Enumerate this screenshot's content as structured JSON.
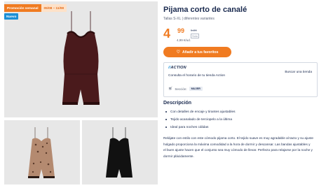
{
  "badges": {
    "promo_label": "Promoción semanal",
    "promo_dates": "05/08 – 11/08",
    "new_label": "Nuevo"
  },
  "product": {
    "title": "Pijama corto de canalé",
    "variants": "Tallas S-XL | diferentes variantes",
    "price_int": "4",
    "price_dec": "99",
    "old_price": "5,99",
    "sale_tag": "Solo",
    "unit_price": "4,99 €/ud.",
    "fav_button": "Añadir a tus favoritos"
  },
  "store": {
    "logo": "ACTION",
    "consult": "Consulta el horario de tu tienda Action",
    "find_store": "Buscar una tienda",
    "section_label": "Sección:",
    "section_value": "MUJER"
  },
  "description": {
    "title": "Descripción",
    "bullets": [
      "Con detalles de encaje y tirantes ajustables",
      "Tejido acanalado de terciopelo a la última",
      "Ideal para noches cálidas"
    ],
    "text": "Relájate con estilo con este cómodo pijama corto. El tejido suave es muy agradable al tacto y su ajuste holgado proporciona la máxima comodidad a la hora de dormir y descansar. Las bandas ajustables y el buen ajuste hacen que el conjunto sea muy cómodo de llevar. Perfecto para relajarse por la noche y dormir plácidamente."
  },
  "colors": {
    "accent_orange": "#f07b21",
    "navy": "#1a2a4f",
    "badge_blue": "#1c8fd6",
    "garment_main": "#4a1a1c",
    "garment_leopard": "#b48a70",
    "garment_black": "#111111"
  }
}
